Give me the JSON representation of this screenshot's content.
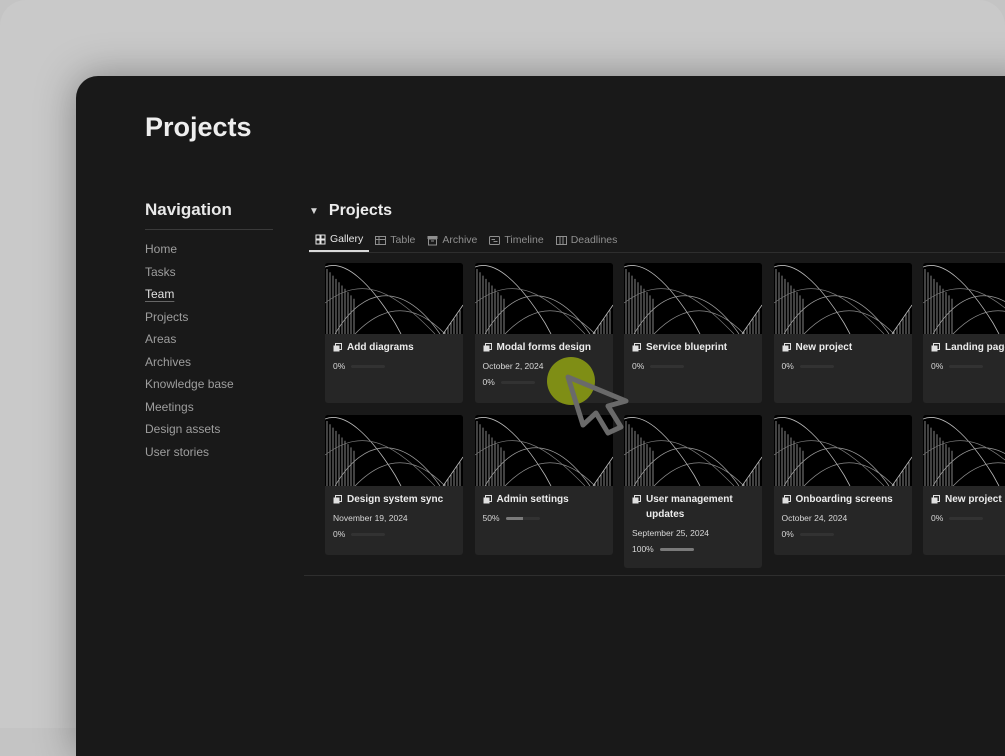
{
  "page": {
    "title": "Projects"
  },
  "navigation": {
    "heading": "Navigation",
    "items": [
      {
        "label": "Home"
      },
      {
        "label": "Tasks"
      },
      {
        "label": "Team",
        "active": true
      },
      {
        "label": "Projects"
      },
      {
        "label": "Areas"
      },
      {
        "label": "Archives"
      },
      {
        "label": "Knowledge base"
      },
      {
        "label": "Meetings"
      },
      {
        "label": "Design assets"
      },
      {
        "label": "User stories"
      }
    ]
  },
  "section": {
    "title": "Projects",
    "tabs": [
      {
        "label": "Gallery",
        "icon": "gallery-icon",
        "active": true
      },
      {
        "label": "Table",
        "icon": "table-icon"
      },
      {
        "label": "Archive",
        "icon": "archive-icon"
      },
      {
        "label": "Timeline",
        "icon": "timeline-icon"
      },
      {
        "label": "Deadlines",
        "icon": "deadlines-icon"
      }
    ]
  },
  "cards": [
    {
      "title": "Add diagrams",
      "date": "",
      "progress_label": "0%",
      "progress": 0
    },
    {
      "title": "Modal forms design",
      "date": "October 2, 2024",
      "progress_label": "0%",
      "progress": 0
    },
    {
      "title": "Service blueprint",
      "date": "",
      "progress_label": "0%",
      "progress": 0
    },
    {
      "title": "New project",
      "date": "",
      "progress_label": "0%",
      "progress": 0
    },
    {
      "title": "Landing page",
      "date": "",
      "progress_label": "0%",
      "progress": 0
    },
    {
      "title": "Design system sync",
      "date": "November 19, 2024",
      "progress_label": "0%",
      "progress": 0
    },
    {
      "title": "Admin settings",
      "date": "",
      "progress_label": "50%",
      "progress": 0.5
    },
    {
      "title": "User management updates",
      "date": "September 25, 2024",
      "progress_label": "100%",
      "progress": 1.0
    },
    {
      "title": "Onboarding screens",
      "date": "October 24, 2024",
      "progress_label": "0%",
      "progress": 0
    },
    {
      "title": "New project",
      "date": "",
      "progress_label": "0%",
      "progress": 0
    }
  ],
  "colors": {
    "background": "#191919",
    "card": "#262626",
    "cursor_highlight": "#8a9a14"
  }
}
